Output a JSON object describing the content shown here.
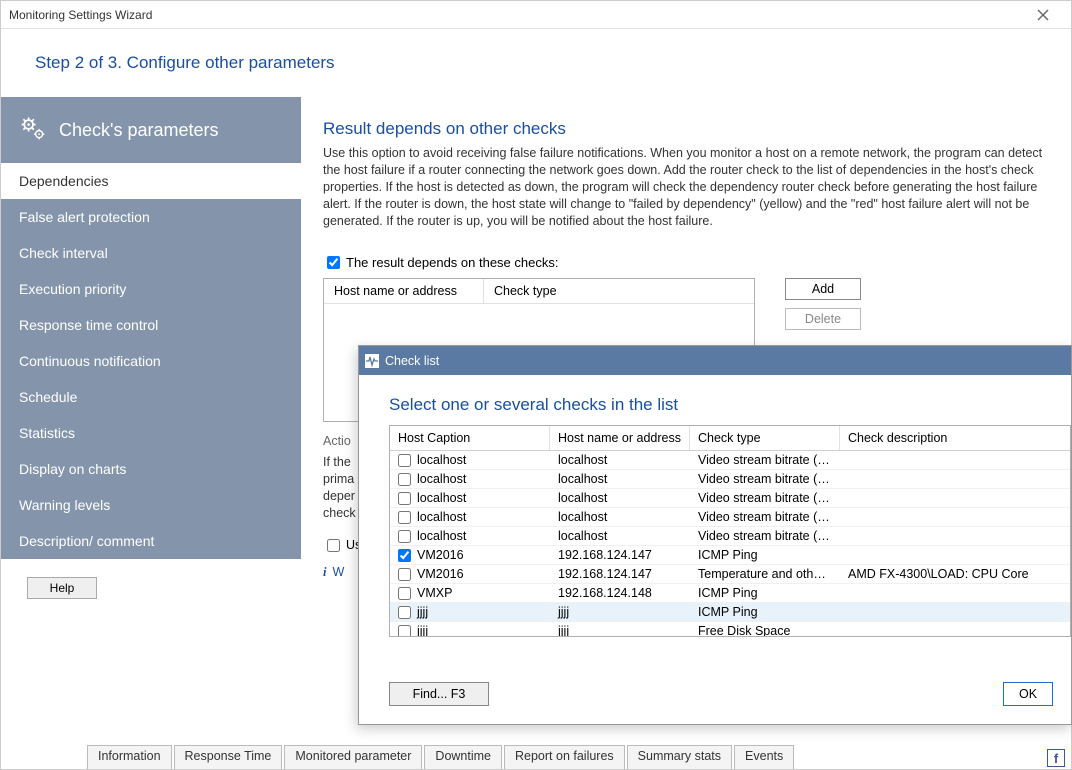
{
  "window": {
    "title": "Monitoring Settings Wizard"
  },
  "wizard": {
    "step_text": "Step 2 of 3. Configure other parameters"
  },
  "sidebar": {
    "heading": "Check's parameters",
    "items": [
      {
        "label": "Dependencies",
        "active": true
      },
      {
        "label": "False alert protection",
        "active": false
      },
      {
        "label": "Check interval",
        "active": false
      },
      {
        "label": "Execution priority",
        "active": false
      },
      {
        "label": "Response time control",
        "active": false
      },
      {
        "label": "Continuous notification",
        "active": false
      },
      {
        "label": "Schedule",
        "active": false
      },
      {
        "label": "Statistics",
        "active": false
      },
      {
        "label": "Display on charts",
        "active": false
      },
      {
        "label": "Warning levels",
        "active": false
      },
      {
        "label": "Description/ comment",
        "active": false
      }
    ],
    "help_label": "Help"
  },
  "content": {
    "section_title": "Result depends on other checks",
    "section_desc": "Use this option to avoid receiving false failure notifications. When you monitor a host on a remote network, the program can detect the host failure if a router connecting the network goes down. Add the router check to the list of dependencies in the host's check properties. If the host is detected as down, the program will check the dependency router check before generating the host failure alert. If the router is down, the host state will change to \"failed by dependency\" (yellow) and the \"red\" host failure alert will not be generated. If the router is up, you will be notified about the host failure.",
    "dep_checkbox_label": "The result depends on these checks:",
    "dep_checkbox_checked": true,
    "grid_header": {
      "col1": "Host name or address",
      "col2": "Check type"
    },
    "add_label": "Add",
    "delete_label": "Delete",
    "actions_heading": "Actio",
    "actions_desc_partial": "If the\nprima\ndeper\ncheck",
    "use_main_checkbox_label": "Us",
    "use_main_checked": false,
    "info_partial": "W"
  },
  "dialog": {
    "title": "Check list",
    "subtitle": "Select one or several checks in the list",
    "columns": {
      "c1": "Host Caption",
      "c2": "Host name or address",
      "c3": "Check type",
      "c4": "Check description"
    },
    "rows": [
      {
        "checked": false,
        "caption": "localhost",
        "host": "localhost",
        "type": "Video stream bitrate (RT...",
        "desc": "",
        "selected": false
      },
      {
        "checked": false,
        "caption": "localhost",
        "host": "localhost",
        "type": "Video stream bitrate (RT...",
        "desc": "",
        "selected": false
      },
      {
        "checked": false,
        "caption": "localhost",
        "host": "localhost",
        "type": "Video stream bitrate (RT...",
        "desc": "",
        "selected": false
      },
      {
        "checked": false,
        "caption": "localhost",
        "host": "localhost",
        "type": "Video stream bitrate (RT...",
        "desc": "",
        "selected": false
      },
      {
        "checked": false,
        "caption": "localhost",
        "host": "localhost",
        "type": "Video stream bitrate (RT...",
        "desc": "",
        "selected": false
      },
      {
        "checked": true,
        "caption": "VM2016",
        "host": "192.168.124.147",
        "type": "ICMP Ping",
        "desc": "",
        "selected": false
      },
      {
        "checked": false,
        "caption": "VM2016",
        "host": "192.168.124.147",
        "type": "Temperature and other ...",
        "desc": "AMD FX-4300\\LOAD:  CPU Core",
        "selected": false
      },
      {
        "checked": false,
        "caption": "VMXP",
        "host": "192.168.124.148",
        "type": "ICMP Ping",
        "desc": "",
        "selected": false
      },
      {
        "checked": false,
        "caption": "jjjj",
        "host": "jjjj",
        "type": "ICMP Ping",
        "desc": "",
        "selected": true
      },
      {
        "checked": false,
        "caption": "jjjj",
        "host": "jjjj",
        "type": "Free Disk Space",
        "desc": "",
        "selected": false
      }
    ],
    "find_label": "Find... F3",
    "ok_label": "OK"
  },
  "bottom_tabs": [
    "Information",
    "Response Time",
    "Monitored parameter",
    "Downtime",
    "Report on failures",
    "Summary stats",
    "Events"
  ]
}
